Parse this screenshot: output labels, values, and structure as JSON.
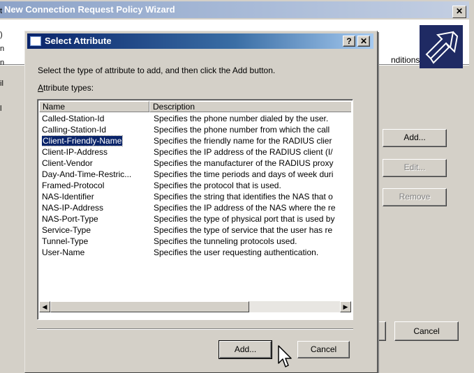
{
  "wizard": {
    "title": "New Connection Request Policy Wizard",
    "close_glyph": "✕",
    "conditions_text": "nditions",
    "add_label": "Add...",
    "edit_label": "Edit...",
    "remove_label": "Remove",
    "cancel_label": "Cancel",
    "left_fragments": [
      "t",
      ")",
      "n",
      "n",
      "il",
      "l"
    ]
  },
  "dialog": {
    "title": "Select Attribute",
    "help_glyph": "?",
    "close_glyph": "✕",
    "instruction": "Select the type of attribute to add, and then click the Add button.",
    "types_label_accel": "A",
    "types_label_rest": "ttribute types:",
    "columns": [
      "Name",
      "Description"
    ],
    "rows": [
      {
        "name": "Called-Station-Id",
        "description": "Specifies the phone number dialed by the user."
      },
      {
        "name": "Calling-Station-Id",
        "description": "Specifies the phone number from which the call"
      },
      {
        "name": "Client-Friendly-Name",
        "description": "Specifies the friendly name for the RADIUS clier"
      },
      {
        "name": "Client-IP-Address",
        "description": "Specifies the IP address of the RADIUS client (I/"
      },
      {
        "name": "Client-Vendor",
        "description": "Specifies the manufacturer of the RADIUS proxy"
      },
      {
        "name": "Day-And-Time-Restric...",
        "description": "Specifies the time periods and days of week duri"
      },
      {
        "name": "Framed-Protocol",
        "description": "Specifies the protocol that is used."
      },
      {
        "name": "NAS-Identifier",
        "description": "Specifies the string that identifies the NAS that o"
      },
      {
        "name": "NAS-IP-Address",
        "description": "Specifies the IP address of the NAS where the re"
      },
      {
        "name": "NAS-Port-Type",
        "description": "Specifies the type of physical port that is used by"
      },
      {
        "name": "Service-Type",
        "description": "Specifies the type of service that the user has re"
      },
      {
        "name": "Tunnel-Type",
        "description": "Specifies the tunneling protocols used."
      },
      {
        "name": "User-Name",
        "description": "Specifies the user requesting authentication."
      }
    ],
    "selected_row": 2,
    "scroll_left_glyph": "◀",
    "scroll_right_glyph": "▶",
    "add_label": "Add...",
    "cancel_label": "Cancel"
  },
  "icons": {
    "wizard_logo": "arrow-icon",
    "cursor": "mouse-pointer-icon"
  },
  "colors": {
    "active_title": "#0a246a",
    "inactive_title": "#8da3c8",
    "face": "#d4d0c8",
    "selection": "#0a246a"
  }
}
